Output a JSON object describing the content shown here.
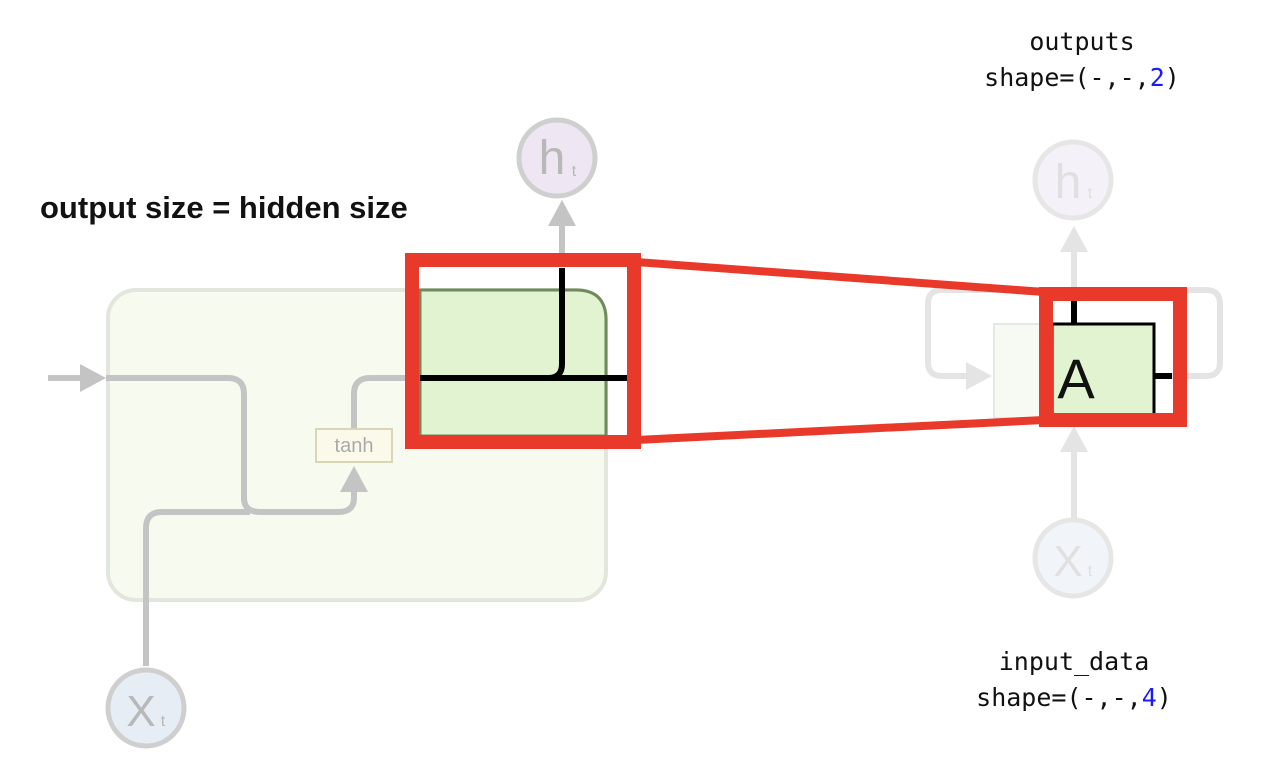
{
  "caption": "output size = hidden size",
  "outputs": {
    "name": "outputs",
    "shape_prefix": "shape=(-,-,",
    "shape_value": "2",
    "shape_suffix": ")"
  },
  "input_data": {
    "name": "input_data",
    "shape_prefix": "shape=(-,-,",
    "shape_value": "4",
    "shape_suffix": ")"
  },
  "cell": {
    "activation_label": "tanh",
    "hidden_node": {
      "main": "h",
      "sub": "t"
    },
    "input_node": {
      "main": "X",
      "sub": "t"
    },
    "unit_label": "A"
  },
  "colors": {
    "highlight": "#e8392a",
    "cell_fill": "#e2f3d2",
    "faded_fill": "#f5faee",
    "arrow_gray": "#c4c4c4",
    "h_node": "#eee6f3",
    "x_node": "#e6edf5",
    "link_blue": "#1a1aff"
  }
}
